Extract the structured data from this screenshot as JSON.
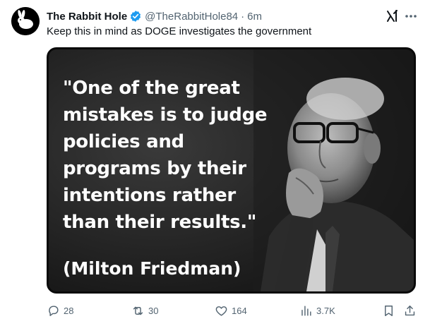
{
  "tweet": {
    "display_name": "The Rabbit Hole",
    "handle": "@TheRabbitHole84",
    "separator": "·",
    "time": "6m",
    "text": "Keep this in mind as DOGE investigates the government"
  },
  "media": {
    "quote": "\"One of the great mistakes is to judge policies and programs by their intentions rather than their results.\"",
    "attribution": "(Milton Friedman)"
  },
  "actions": {
    "replies": "28",
    "reposts": "30",
    "likes": "164",
    "views": "3.7K"
  },
  "icons": {
    "verified": "verified-badge-icon",
    "grok": "grok-icon",
    "more": "more-icon",
    "reply": "reply-icon",
    "repost": "repost-icon",
    "like": "heart-icon",
    "views": "views-icon",
    "bookmark": "bookmark-icon",
    "share": "share-icon"
  },
  "colors": {
    "verified": "#1d9bf0",
    "secondary_text": "#536471",
    "primary_text": "#0f1419"
  }
}
